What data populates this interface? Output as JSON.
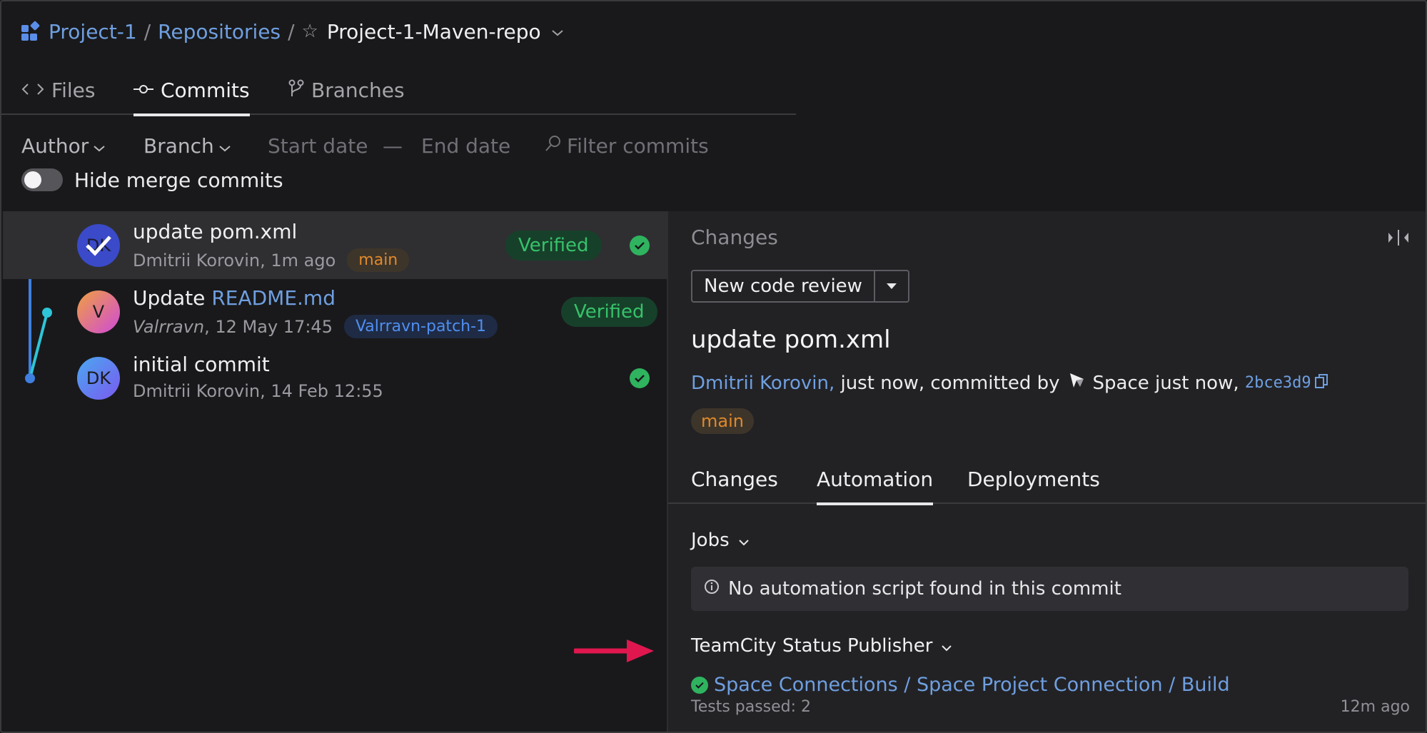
{
  "breadcrumb": {
    "project": "Project-1",
    "sep1": "/",
    "section": "Repositories",
    "sep2": "/",
    "repo": "Project-1-Maven-repo"
  },
  "tabs": [
    {
      "label": "Files",
      "icon": "code-brackets-icon"
    },
    {
      "label": "Commits",
      "icon": "commit-icon",
      "active": true
    },
    {
      "label": "Branches",
      "icon": "branch-icon"
    }
  ],
  "filters": {
    "author": "Author",
    "branch": "Branch",
    "start_date": "Start date",
    "dash": "—",
    "end_date": "End date",
    "search_placeholder": "Filter commits"
  },
  "hide_merge": {
    "label": "Hide merge commits",
    "enabled": false
  },
  "commits": [
    {
      "title": "update pom.xml",
      "author": "Dmitrii Korovin",
      "time": "1m ago",
      "branch": "main",
      "verified": "Verified",
      "status": "success",
      "selected": true,
      "avatar_initials": "DK"
    },
    {
      "title_prefix": "Update ",
      "title_link": "README.md",
      "author": "Valrravn",
      "time": "12 May 17:45",
      "branch": "Valrravn-patch-1",
      "verified": "Verified",
      "avatar_initials": "V"
    },
    {
      "title": "initial commit",
      "author": "Dmitrii Korovin",
      "time": "14 Feb 12:55",
      "status": "success",
      "avatar_initials": "DK"
    }
  ],
  "panel": {
    "changes_header": "Changes",
    "review_button": "New code review",
    "commit_title": "update pom.xml",
    "author_link": "Dmitrii Korovin,",
    "meta_mid": "just now, committed by",
    "committer": "Space just now,",
    "hash": "2bce3d9",
    "branch": "main",
    "tabs": [
      "Changes",
      "Automation",
      "Deployments"
    ],
    "active_tab": "Automation",
    "jobs_label": "Jobs",
    "no_script": "No automation script found in this commit",
    "publisher_label": "TeamCity Status Publisher",
    "build_link": "Space Connections / Space Project Connection / Build",
    "tests": "Tests passed: 2",
    "ago": "12m ago"
  },
  "colors": {
    "link": "#6f9fe0",
    "verified_bg": "#17402a",
    "verified_text": "#37c26a",
    "branch_main": "#e0892a",
    "branch_patch": "#4f8ff0",
    "arrow": "#e0174f"
  }
}
